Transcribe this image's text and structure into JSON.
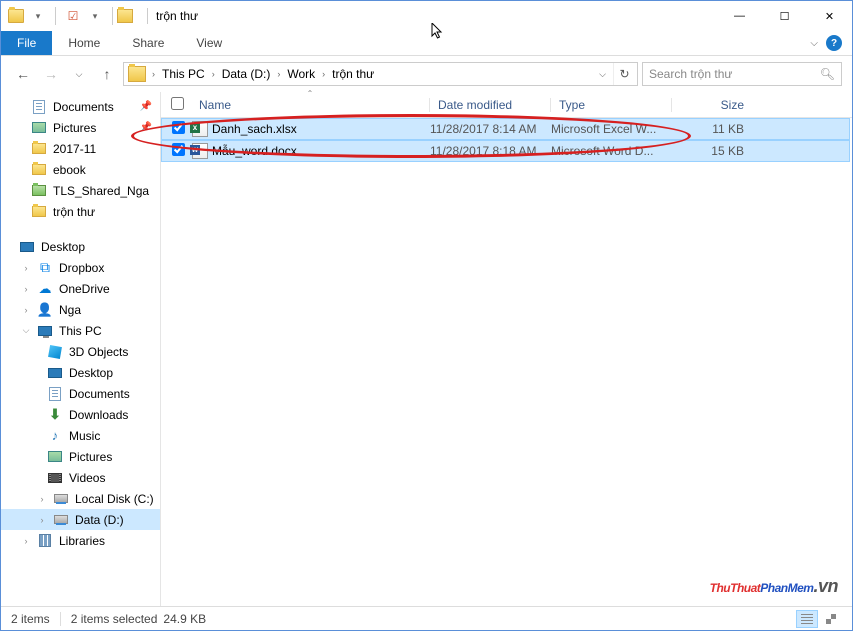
{
  "window": {
    "title": "trộn thư",
    "min": "—",
    "max": "☐",
    "close": "✕"
  },
  "ribbon": {
    "file": "File",
    "home": "Home",
    "share": "Share",
    "view": "View"
  },
  "breadcrumbs": {
    "root": "This PC",
    "drive": "Data (D:)",
    "folder1": "Work",
    "folder2": "trộn thư"
  },
  "search": {
    "placeholder": "Search trộn thư"
  },
  "columns": {
    "name": "Name",
    "date": "Date modified",
    "type": "Type",
    "size": "Size"
  },
  "files": [
    {
      "name": "Danh_sach.xlsx",
      "date": "11/28/2017 8:14 AM",
      "type": "Microsoft Excel W...",
      "size": "11 KB",
      "icon": "excel"
    },
    {
      "name": "Mẫu_word.docx",
      "date": "11/28/2017 8:18 AM",
      "type": "Microsoft Word D...",
      "size": "15 KB",
      "icon": "word"
    }
  ],
  "sidebar": {
    "documents": "Documents",
    "pictures": "Pictures",
    "f201711": "2017-11",
    "ebook": "ebook",
    "tls": "TLS_Shared_Nga",
    "tronthu": "trộn thư",
    "desktop": "Desktop",
    "dropbox": "Dropbox",
    "onedrive": "OneDrive",
    "nga": "Nga",
    "thispc": "This PC",
    "obj3d": "3D Objects",
    "desktop2": "Desktop",
    "documents2": "Documents",
    "downloads": "Downloads",
    "music": "Music",
    "pictures2": "Pictures",
    "videos": "Videos",
    "diskC": "Local Disk (C:)",
    "diskD": "Data (D:)",
    "libraries": "Libraries"
  },
  "status": {
    "count": "2 items",
    "selected": "2 items selected",
    "size": "24.9 KB"
  },
  "watermark": {
    "p1": "ThuThuat",
    "p2": "PhanMem",
    "p3": ".vn"
  }
}
